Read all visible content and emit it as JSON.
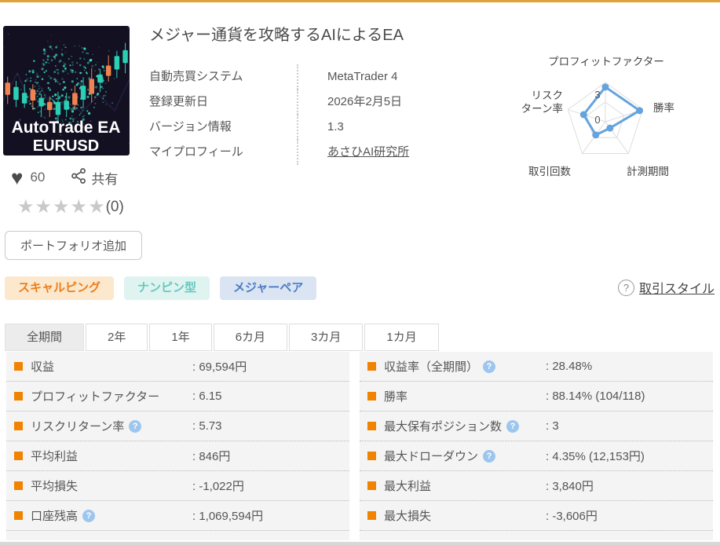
{
  "colors": {
    "topbar": "#dfa23b",
    "accent_orange": "#f08300",
    "radar_line": "#64a3de"
  },
  "product": {
    "title": "メジャー通貨を攻略するAIによるEA",
    "image": {
      "line1": "AutoTrade EA",
      "line2": "EURUSD"
    },
    "details": [
      {
        "label": "自動売買システム",
        "value": "MetaTrader 4",
        "link": false
      },
      {
        "label": "登録更新日",
        "value": "2026年2月5日",
        "link": false
      },
      {
        "label": "バージョン情報",
        "value": "1.3",
        "link": false
      },
      {
        "label": "マイプロフィール",
        "value": "あさひAI研究所",
        "link": true
      }
    ],
    "likes": "60",
    "share_label": "共有",
    "stars": "★★★★★",
    "rating_count": "(0)",
    "portfolio_button": "ポートフォリオ追加",
    "tags": [
      {
        "label": "スキャルピング",
        "style": "orange"
      },
      {
        "label": "ナンピン型",
        "style": "teal"
      },
      {
        "label": "メジャーペア",
        "style": "blue"
      }
    ],
    "trade_style_link": "取引スタイル"
  },
  "tag_colors": {
    "orange": {
      "bg": "#fce8cd",
      "fg": "#ee7d1b"
    },
    "teal": {
      "bg": "#dff4f0",
      "fg": "#68c8bf"
    },
    "blue": {
      "bg": "#dae4f3",
      "fg": "#4b7cc3"
    }
  },
  "tabs": [
    {
      "label": "全期間",
      "active": true
    },
    {
      "label": "2年",
      "active": false
    },
    {
      "label": "1年",
      "active": false
    },
    {
      "label": "6カ月",
      "active": false
    },
    {
      "label": "3カ月",
      "active": false
    },
    {
      "label": "1カ月",
      "active": false
    }
  ],
  "stats": {
    "left": [
      {
        "label": "収益",
        "value": ": 69,594円",
        "help": false
      },
      {
        "label": "プロフィットファクター",
        "value": ": 6.15",
        "help": false
      },
      {
        "label": "リスクリターン率",
        "value": ": 5.73",
        "help": true
      },
      {
        "label": "平均利益",
        "value": ": 846円",
        "help": false
      },
      {
        "label": "平均損失",
        "value": ": -1,022円",
        "help": false
      },
      {
        "label": "口座残高",
        "value": ": 1,069,594円",
        "help": true
      }
    ],
    "right": [
      {
        "label": "収益率（全期間）",
        "value": ": 28.48%",
        "help": true
      },
      {
        "label": "勝率",
        "value": ": 88.14% (104/118)",
        "help": false
      },
      {
        "label": "最大保有ポジション数",
        "value": ": 3",
        "help": true
      },
      {
        "label": "最大ドローダウン",
        "value": ": 4.35% (12,153円)",
        "help": true
      },
      {
        "label": "最大利益",
        "value": ": 3,840円",
        "help": false
      },
      {
        "label": "最大損失",
        "value": ": -3,606円",
        "help": false
      }
    ]
  },
  "chart_data": {
    "type": "radar",
    "axes": [
      "プロフィットファクター",
      "勝率",
      "計測期間",
      "取引回数",
      "リスク\nターン率"
    ],
    "values": [
      5.3,
      5.5,
      1.2,
      2.5,
      3.5
    ],
    "max": 6,
    "ticks": [
      {
        "label": "3",
        "at": 0.5
      },
      {
        "label": "0",
        "at": 0
      }
    ],
    "grid_rings": [
      0.5,
      1
    ],
    "line_color": "#64a3de",
    "grid_color": "#dddddd",
    "legend": "none"
  }
}
